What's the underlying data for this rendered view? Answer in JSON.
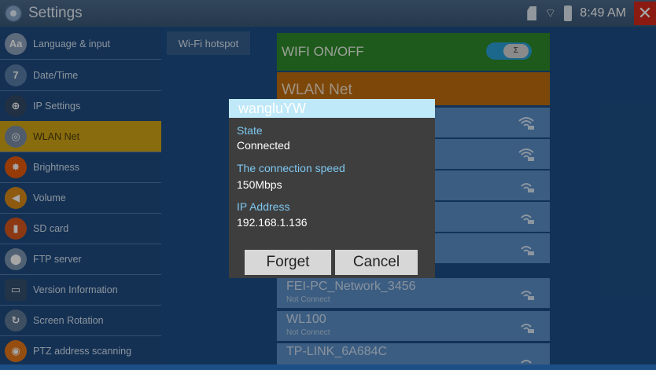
{
  "statusbar": {
    "title": "Settings",
    "time": "8:49 AM"
  },
  "sidebar": {
    "items": [
      {
        "label": "Language & input",
        "icon": "Aa",
        "color": "#8fa4bd"
      },
      {
        "label": "Date/Time",
        "icon": "7",
        "color": "#5a7fa8"
      },
      {
        "label": "IP Settings",
        "icon": "⊕",
        "color": "#334a66"
      },
      {
        "label": "WLAN Net",
        "icon": "◎",
        "color": "#7b8ea6"
      },
      {
        "label": "Brightness",
        "icon": "✸",
        "color": "#e65a0c"
      },
      {
        "label": "Volume",
        "icon": "◀",
        "color": "#d98a18"
      },
      {
        "label": "SD card",
        "icon": "▮",
        "color": "#d6571e"
      },
      {
        "label": "FTP server",
        "icon": "⬤",
        "color": "#7d96b3"
      },
      {
        "label": "Version Information",
        "icon": "▭",
        "color": "#34506f"
      },
      {
        "label": "Screen Rotation",
        "icon": "↻",
        "color": "#607a97"
      },
      {
        "label": "PTZ address scanning",
        "icon": "◉",
        "color": "#e6781a"
      }
    ]
  },
  "main": {
    "tab": "Wi-Fi hotspot",
    "wifi_toggle_label": "WIFI ON/OFF",
    "wlan_label": "WLAN Net",
    "networks": [
      {
        "name": "FEI-PC_Network_3456",
        "status": "Not Connect"
      },
      {
        "name": "WL100",
        "status": "Not Connect"
      },
      {
        "name": "TP-LINK_6A684C",
        "status": ""
      }
    ]
  },
  "dialog": {
    "title": "wangluYW",
    "state_label": "State",
    "state_value": "Connected",
    "speed_label": "The connection speed",
    "speed_value": "150Mbps",
    "ip_label": "IP Address",
    "ip_value": "192.168.1.136",
    "forget": "Forget",
    "cancel": "Cancel"
  }
}
